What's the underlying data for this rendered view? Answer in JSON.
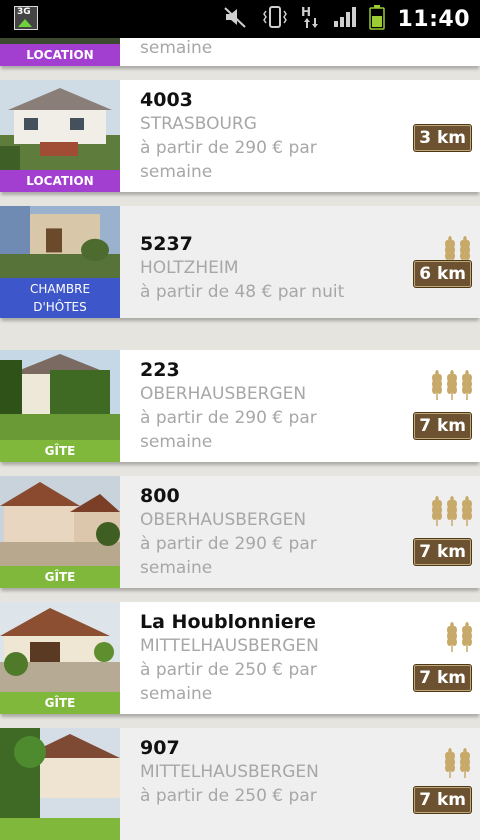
{
  "status_bar": {
    "time": "11:40",
    "network": "H",
    "app_icon_text": "3G",
    "icons": [
      "mute-icon",
      "vibrate-icon",
      "data-transfer-icon",
      "signal-icon",
      "battery-icon"
    ]
  },
  "colors": {
    "location": "#a23ed0",
    "chambre": "#3d56c9",
    "gite": "#7fb83a",
    "distance_bg": "#6c5230",
    "wheat": "#c7a96a"
  },
  "listings": [
    {
      "name": "",
      "city": "",
      "price_line1": "semaine",
      "price_line2": "",
      "category": "LOCATION",
      "category_line2": "",
      "distance": "",
      "wheat_rating": 0,
      "category_color": "#a23ed0"
    },
    {
      "name": "4003",
      "city": "STRASBOURG",
      "price_line1": "à partir de 290 € par",
      "price_line2": "semaine",
      "category": "LOCATION",
      "category_line2": "",
      "distance": "3 km",
      "wheat_rating": 0,
      "category_color": "#a23ed0"
    },
    {
      "name": "5237",
      "city": "HOLTZHEIM",
      "price_line1": "à partir de 48 € par nuit",
      "price_line2": "",
      "category": "CHAMBRE",
      "category_line2": "D'HÔTES",
      "distance": "6 km",
      "wheat_rating": 2,
      "category_color": "#3d56c9"
    },
    {
      "name": "223",
      "city": "OBERHAUSBERGEN",
      "price_line1": "à partir de 290 € par",
      "price_line2": "semaine",
      "category": "GÎTE",
      "category_line2": "",
      "distance": "7 km",
      "wheat_rating": 3,
      "category_color": "#7fb83a"
    },
    {
      "name": "800",
      "city": "OBERHAUSBERGEN",
      "price_line1": "à partir de 290 € par",
      "price_line2": "semaine",
      "category": "GÎTE",
      "category_line2": "",
      "distance": "7 km",
      "wheat_rating": 3,
      "category_color": "#7fb83a"
    },
    {
      "name": "La Houblonniere",
      "city": "MITTELHAUSBERGEN",
      "price_line1": "à partir de 250 € par",
      "price_line2": "semaine",
      "category": "GÎTE",
      "category_line2": "",
      "distance": "7 km",
      "wheat_rating": 2,
      "category_color": "#7fb83a"
    },
    {
      "name": "907",
      "city": "MITTELHAUSBERGEN",
      "price_line1": "à partir de 250 € par",
      "price_line2": "",
      "category": "",
      "category_line2": "",
      "distance": "7 km",
      "wheat_rating": 2,
      "category_color": "#7fb83a"
    }
  ]
}
